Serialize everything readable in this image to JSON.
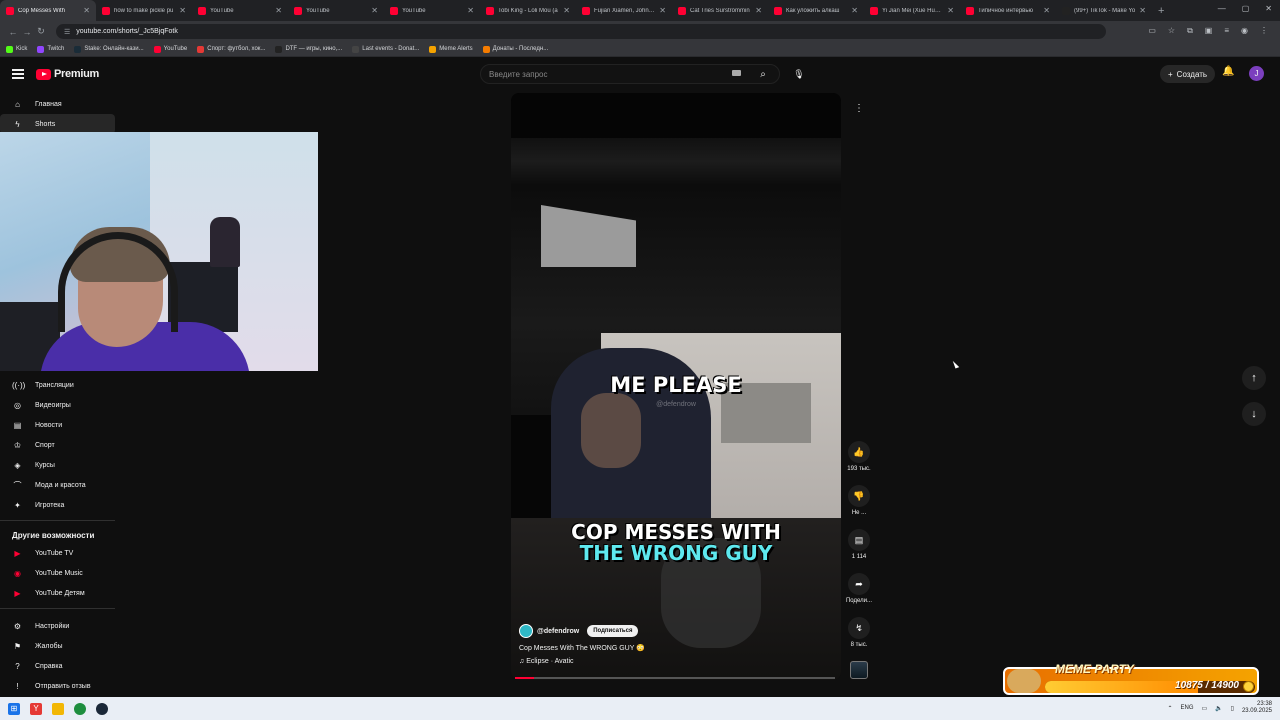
{
  "browser": {
    "tabs": [
      {
        "title": "Cop Messes With",
        "active": true,
        "favicon_color": "#ff0033"
      },
      {
        "title": "how to make pickle pu",
        "favicon_color": "#ff0033"
      },
      {
        "title": "YouTube",
        "favicon_color": "#ff0033"
      },
      {
        "title": "YouTube",
        "favicon_color": "#ff0033"
      },
      {
        "title": "YouTube",
        "favicon_color": "#ff0033"
      },
      {
        "title": "Tobi King - Loli Mou (a",
        "favicon_color": "#ff0033"
      },
      {
        "title": "Fujian Xiamen, John Pr",
        "favicon_color": "#ff0033"
      },
      {
        "title": "Cat Tries Surströmmin",
        "favicon_color": "#ff0033"
      },
      {
        "title": "Как уложить алкаш",
        "favicon_color": "#ff0033"
      },
      {
        "title": "Yi Jian Mei (Xue Hua P",
        "favicon_color": "#ff0033"
      },
      {
        "title": "Типичное интервью",
        "favicon_color": "#ff0033"
      },
      {
        "title": "(99+) TikTok - Make Yo",
        "favicon_color": "#222222"
      }
    ],
    "url": "youtube.com/shorts/_Jc5BjqFotk",
    "bookmarks": [
      {
        "label": "Kick",
        "color": "#53fc18"
      },
      {
        "label": "Twitch",
        "color": "#9146ff"
      },
      {
        "label": "Stake: Онлайн-кази...",
        "color": "#1a2c38"
      },
      {
        "label": "YouTube",
        "color": "#ff0033"
      },
      {
        "label": "Спорт: футбол, хок...",
        "color": "#e53935"
      },
      {
        "label": "DTF — игры, кино,...",
        "color": "#222222"
      },
      {
        "label": "Last events - Donat...",
        "color": "#444444"
      },
      {
        "label": "Meme Alerts",
        "color": "#f5a300"
      },
      {
        "label": "Донаты - Последн...",
        "color": "#f57c00"
      }
    ]
  },
  "header": {
    "logo_text": "Premium",
    "search_placeholder": "Введите запрос",
    "create_label": "Создать",
    "avatar_letter": "J"
  },
  "sidebar": {
    "top_items": [
      {
        "label": "Главная",
        "icon": "home-icon"
      },
      {
        "label": "Shorts",
        "icon": "shorts-icon",
        "active": true
      }
    ],
    "explore_items": [
      {
        "label": "Трансляции",
        "icon": "live-icon"
      },
      {
        "label": "Видеоигры",
        "icon": "gamepad-icon"
      },
      {
        "label": "Новости",
        "icon": "news-icon"
      },
      {
        "label": "Спорт",
        "icon": "trophy-icon"
      },
      {
        "label": "Курсы",
        "icon": "courses-icon"
      },
      {
        "label": "Мода и красота",
        "icon": "hanger-icon"
      },
      {
        "label": "Игротека",
        "icon": "playables-icon"
      }
    ],
    "more_heading": "Другие возможности",
    "more_items": [
      {
        "label": "YouTube TV",
        "icon": "youtube-tv-icon"
      },
      {
        "label": "YouTube Music",
        "icon": "youtube-music-icon"
      },
      {
        "label": "YouTube Детям",
        "icon": "youtube-kids-icon"
      }
    ],
    "footer_items": [
      {
        "label": "Настройки",
        "icon": "gear-icon"
      },
      {
        "label": "Жалобы",
        "icon": "flag-icon"
      },
      {
        "label": "Справка",
        "icon": "help-icon"
      },
      {
        "label": "Отправить отзыв",
        "icon": "feedback-icon"
      }
    ]
  },
  "short": {
    "caption_mid": "ME PLEASE",
    "watermark": "@defendrow",
    "caption_line1": "COP MESSES WITH",
    "caption_line2": "THE WRONG GUY",
    "channel": "@defendrow",
    "subscribe_label": "Подписаться",
    "title": "Cop Messes With The WRONG GUY 😳",
    "music": "♫ Eclipse · Avatic",
    "progress_fraction": 0.06
  },
  "actions": {
    "likes": "193 тыс.",
    "dislike_label": "Не ...",
    "comments": "1 114",
    "share_label": "Подели...",
    "remix_count": "8 тыс."
  },
  "overlay": {
    "meme_title": "MEME PARTY",
    "meme_value": "10875 / 14900",
    "meme_fraction": 0.73
  },
  "taskbar": {
    "lang": "ENG",
    "time": "23:38",
    "date": "23.09.2025"
  }
}
